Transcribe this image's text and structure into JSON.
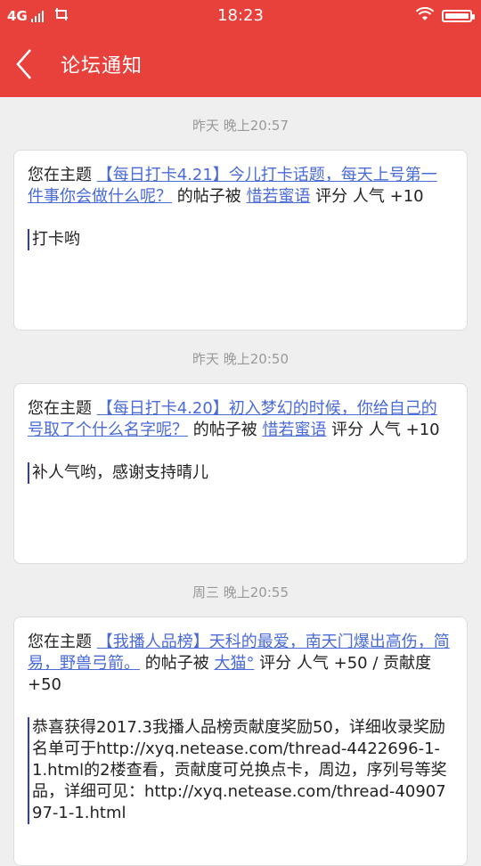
{
  "status_bar": {
    "network": "4G",
    "time": "18:23",
    "battery_level": 1.0
  },
  "header": {
    "title": "论坛通知"
  },
  "notifications": [
    {
      "time": "昨天  晚上20:57",
      "prefix": "您在主题 ",
      "topic": "【每日打卡4.21】今儿打卡话题，每天上号第一件事你会做什么呢？",
      "middle": " 的帖子被 ",
      "user": "惜若蜜语",
      "suffix": " 评分 人气 +10",
      "quote": "打卡哟"
    },
    {
      "time": "昨天  晚上20:50",
      "prefix": "您在主题 ",
      "topic": "【每日打卡4.20】初入梦幻的时候，你给自己的号取了个什么名字呢？",
      "middle": " 的帖子被 ",
      "user": "惜若蜜语",
      "suffix": " 评分 人气 +10",
      "quote": "补人气哟，感谢支持晴儿"
    },
    {
      "time": "周三  晚上20:55",
      "prefix": "您在主题 ",
      "topic": "【我播人品榜】天科的最爱，南天门爆出高伤，简易，野兽弓箭。",
      "middle": " 的帖子被 ",
      "user": "大猫°",
      "suffix": " 评分 人气 +50 / 贡献度 +50",
      "quote": "恭喜获得2017.3我播人品榜贡献度奖励50，详细收录奖励名单可于http://xyq.netease.com/thread-4422696-1-1.html的2楼查看，贡献度可兑换点卡，周边，序列号等奖品，详细可见：http://xyq.netease.com/thread-4090797-1-1.html"
    }
  ],
  "colors": {
    "brand": "#e8413b",
    "link": "#4a6ad6",
    "quote_bar": "#2c3bcf"
  }
}
